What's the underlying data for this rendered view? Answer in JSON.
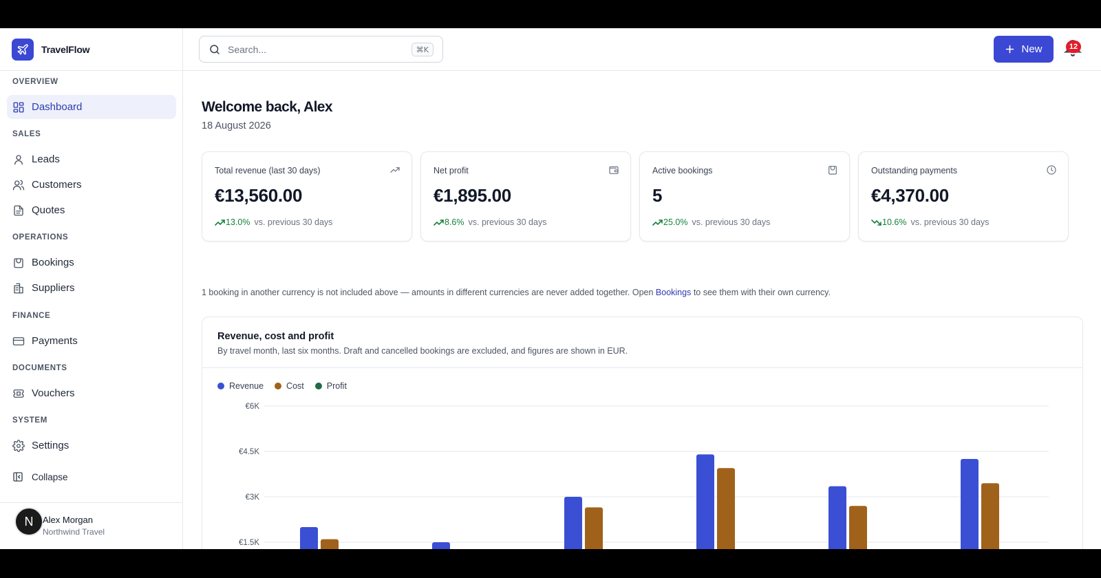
{
  "app": {
    "name": "TravelFlow",
    "logo_icon": "plane-icon",
    "accent": "#3b48d4"
  },
  "sidebar": {
    "sections": [
      {
        "label": "OVERVIEW",
        "items": [
          {
            "label": "Dashboard",
            "icon": "dashboard-icon",
            "active": true
          }
        ]
      },
      {
        "label": "SALES",
        "items": [
          {
            "label": "Leads",
            "icon": "user-icon"
          },
          {
            "label": "Customers",
            "icon": "users-icon"
          },
          {
            "label": "Quotes",
            "icon": "document-icon"
          }
        ]
      },
      {
        "label": "OPERATIONS",
        "items": [
          {
            "label": "Bookings",
            "icon": "bag-icon"
          },
          {
            "label": "Suppliers",
            "icon": "building-icon"
          }
        ]
      },
      {
        "label": "FINANCE",
        "items": [
          {
            "label": "Payments",
            "icon": "credit-card-icon"
          }
        ]
      },
      {
        "label": "DOCUMENTS",
        "items": [
          {
            "label": "Vouchers",
            "icon": "ticket-icon"
          }
        ]
      },
      {
        "label": "SYSTEM",
        "items": [
          {
            "label": "Settings",
            "icon": "gear-icon"
          }
        ]
      }
    ],
    "collapse_label": "Collapse",
    "user": {
      "initial": "N",
      "name": "Alex Morgan",
      "org": "Northwind Travel"
    }
  },
  "topbar": {
    "search_placeholder": "Search...",
    "search_shortcut": "⌘K",
    "new_label": "New",
    "notification_count": "12"
  },
  "main": {
    "welcome": "Welcome back, Alex",
    "date": "18 August 2026",
    "cards": [
      {
        "label": "Total revenue (last 30 days)",
        "value": "€13,560.00",
        "delta": "13.0%",
        "direction": "up",
        "compare": "vs. previous 30 days",
        "icon": "trend-up-icon"
      },
      {
        "label": "Net profit",
        "value": "€1,895.00",
        "delta": "8.6%",
        "direction": "up",
        "compare": "vs. previous 30 days",
        "icon": "wallet-icon"
      },
      {
        "label": "Active bookings",
        "value": "5",
        "delta": "25.0%",
        "direction": "up",
        "compare": "vs. previous 30 days",
        "icon": "bag-icon"
      },
      {
        "label": "Outstanding payments",
        "value": "€4,370.00",
        "delta": "10.6%",
        "direction": "down",
        "compare": "vs. previous 30 days",
        "icon": "clock-icon"
      }
    ],
    "note_before": "1 booking in another currency is not included above — amounts in different currencies are never added together. Open ",
    "note_link": "Bookings",
    "note_after": " to see them with their own currency.",
    "chart": {
      "title": "Revenue, cost and profit",
      "subtitle": "By travel month, last six months. Draft and cancelled bookings are excluded, and figures are shown in EUR."
    }
  },
  "colors": {
    "revenue": "#3b4fd4",
    "cost": "#a0621a",
    "profit": "#1f6b4a",
    "positive": "#16803c"
  },
  "chart_data": {
    "type": "bar",
    "categories": [
      "",
      "",
      "",
      "",
      "",
      ""
    ],
    "series": [
      {
        "name": "Revenue",
        "values": [
          2000,
          1500,
          3000,
          4400,
          3350,
          4250
        ]
      },
      {
        "name": "Cost",
        "values": [
          1600,
          1050,
          2650,
          3950,
          2700,
          3450
        ]
      },
      {
        "name": "Profit",
        "values": [
          0,
          0,
          100,
          0,
          150,
          0
        ]
      }
    ],
    "yticks": [
      "€6K",
      "€4.5K",
      "€3K",
      "€1.5K"
    ],
    "ylim": [
      0,
      6000
    ],
    "grid": true,
    "legend": "top-left"
  }
}
